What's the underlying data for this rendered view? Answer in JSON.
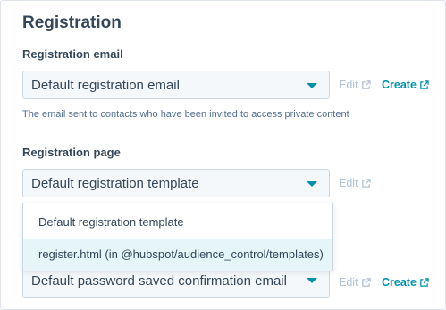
{
  "section": {
    "title": "Registration"
  },
  "registration_email": {
    "label": "Registration email",
    "selected": "Default registration email",
    "edit_label": "Edit",
    "create_label": "Create",
    "help": "The email sent to contacts who have been invited to access private content"
  },
  "registration_page": {
    "label": "Registration page",
    "selected": "Default registration template",
    "edit_label": "Edit",
    "options": [
      "Default registration template",
      "register.html (in @hubspot/audience_control/templates)"
    ]
  },
  "password_email": {
    "selected": "Default password saved confirmation email",
    "edit_label": "Edit",
    "create_label": "Create"
  },
  "colors": {
    "link": "#0091ae",
    "disabled": "#b0c1d4",
    "text": "#33475b",
    "hover": "#e5f5f8"
  },
  "icons": {
    "caret": "caret-down-icon",
    "external": "external-link-icon"
  }
}
